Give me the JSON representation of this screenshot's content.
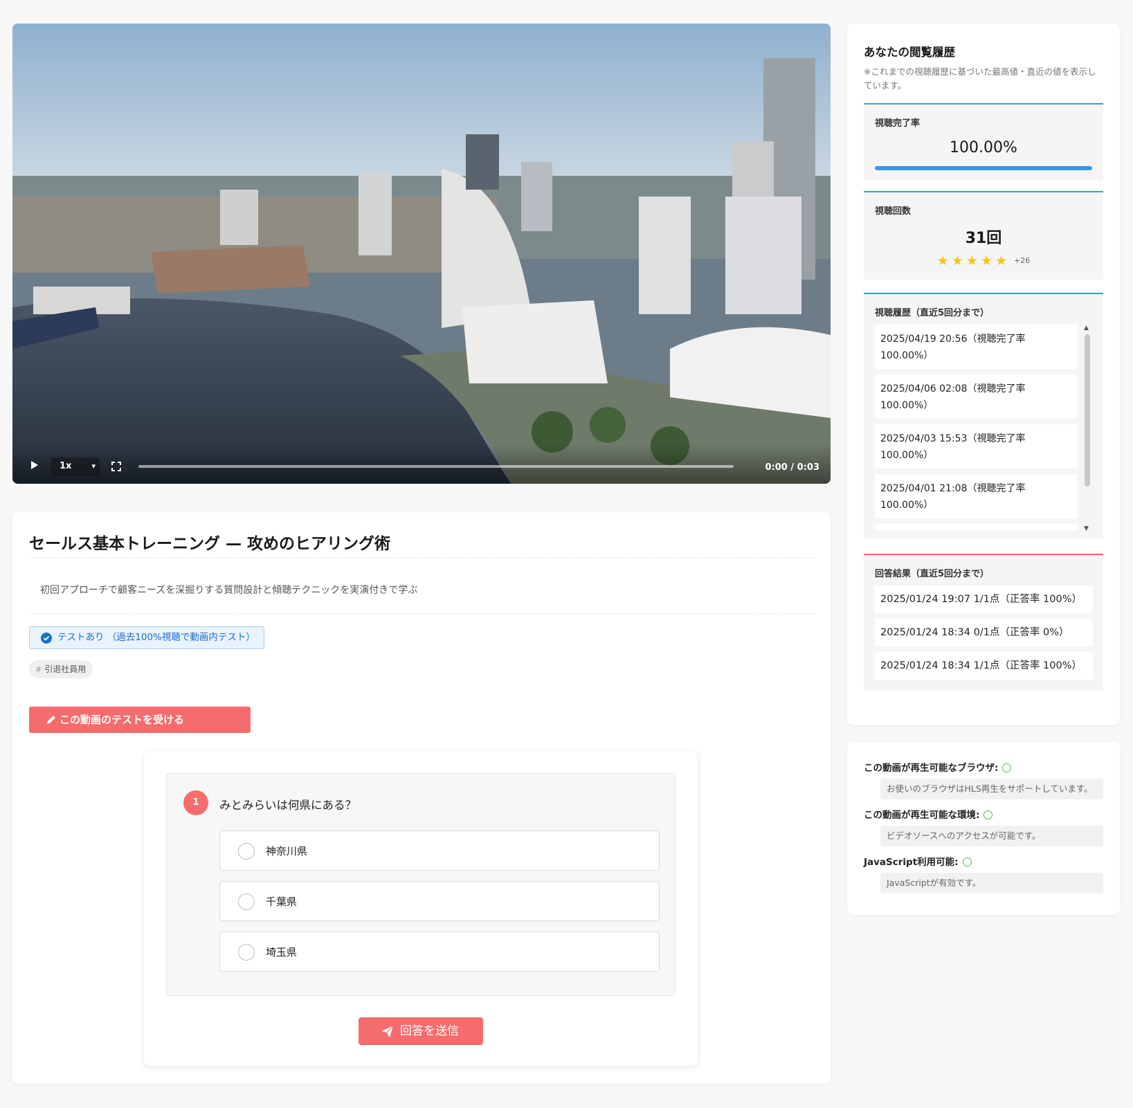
{
  "video": {
    "speed": "1x",
    "time": "0:00 / 0:03",
    "progress": 0.0
  },
  "main": {
    "title": "セールス基本トレーニング — 攻めのヒアリング術",
    "description": "初回アプローチで顧客ニーズを深掘りする質問設計と傾聴テクニックを実演付きで学ぶ",
    "test_badge": "テストあり （過去100%視聴で動画内テスト）",
    "tag": "引退社員用",
    "take_test_label": "この動画のテストを受ける"
  },
  "quiz": {
    "number": "1",
    "question": "みとみらいは何県にある？",
    "options": [
      "神奈川県",
      "千葉県",
      "埼玉県"
    ],
    "submit_label": "回答を送信"
  },
  "history": {
    "title": "あなたの閲覧履歴",
    "note": "※これまでの視聴履歴に基づいた最高値・直近の値を表示しています。",
    "completion": {
      "label": "視聴完了率",
      "value": "100.00%",
      "fraction": 1.0
    },
    "views": {
      "label": "視聴回数",
      "value": "31回",
      "stars": 5,
      "extra": "+26"
    },
    "recent": {
      "label": "視聴履歴（直近5回分まで）",
      "items": [
        "2025/04/19 20:56（視聴完了率 100.00%）",
        "2025/04/06 02:08（視聴完了率 100.00%）",
        "2025/04/03 15:53（視聴完了率 100.00%）",
        "2025/04/01 21:08（視聴完了率 100.00%）"
      ]
    },
    "answers": {
      "label": "回答結果（直近5回分まで）",
      "items": [
        "2025/01/24 19:07 1/1点（正答率 100%）",
        "2025/01/24 18:34 0/1点（正答率 0%）",
        "2025/01/24 18:34 1/1点（正答率 100%）"
      ]
    }
  },
  "environment": {
    "browser_label": "この動画が再生可能なブラウザ:",
    "browser_msg": "お使いのブラウザはHLS再生をサポートしています。",
    "env_label": "この動画が再生可能な環境:",
    "env_msg": "ビデオソースへのアクセスが可能です。",
    "js_label": "JavaScript利用可能:",
    "js_msg": "JavaScriptが有効です。"
  },
  "colors": {
    "accent_red": "#f56c6c",
    "accent_blue": "#3b97e3",
    "star": "#f5c518",
    "ok_green": "#5cb85c"
  },
  "icons": [
    "play-icon",
    "chevron-down-icon",
    "fullscreen-icon",
    "check-circle-icon",
    "pencil-icon",
    "paper-plane-icon",
    "star-icon",
    "circle-status-icon"
  ]
}
